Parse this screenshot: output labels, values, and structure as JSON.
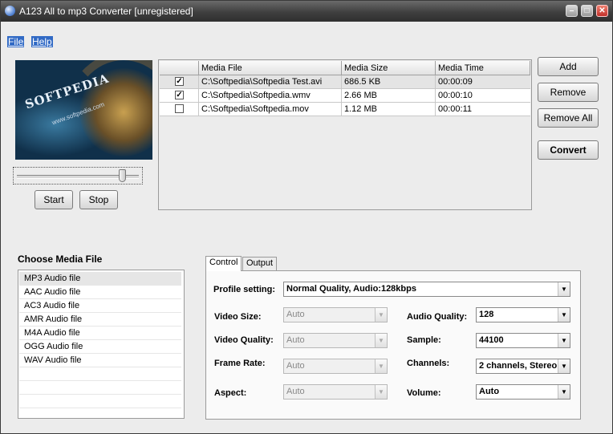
{
  "window": {
    "title": "A123 All to mp3 Converter  [unregistered]",
    "min_glyph": "–",
    "max_glyph": "□",
    "close_glyph": "✕"
  },
  "menu": {
    "items": [
      "File",
      "Help"
    ]
  },
  "preview": {
    "logo_text": "SOFTPEDIA",
    "sub_text": "www.softpedia.com",
    "seek_level": 0.89
  },
  "player": {
    "start": "Start",
    "stop": "Stop"
  },
  "actions": {
    "add": "Add",
    "remove": "Remove",
    "remove_all": "Remove All",
    "convert": "Convert"
  },
  "media_table": {
    "columns": [
      "Media File",
      "Media Size",
      "Media Time"
    ],
    "rows": [
      {
        "checked": true,
        "file": "C:\\Softpedia\\Softpedia Test.avi",
        "size": "686.5 KB",
        "time": "00:00:09"
      },
      {
        "checked": true,
        "file": "C:\\Softpedia\\Softpedia.wmv",
        "size": "2.66 MB",
        "time": "00:00:10"
      },
      {
        "checked": false,
        "file": "C:\\Softpedia\\Softpedia.mov",
        "size": "1.12 MB",
        "time": "00:00:11"
      }
    ],
    "check_glyph": "✓"
  },
  "choose_media": {
    "title": "Choose Media File",
    "items": [
      "MP3 Audio file",
      "AAC Audio file",
      "AC3 Audio file",
      "AMR Audio file",
      "M4A Audio file",
      "OGG Audio file",
      "WAV Audio file"
    ]
  },
  "tabs": [
    "Control",
    "Output"
  ],
  "settings": {
    "profile_label": "Profile setting:",
    "profile_value": "Normal Quality, Audio:128kbps",
    "video_size_label": "Video Size:",
    "video_size_value": "Auto",
    "video_quality_label": "Video Quality:",
    "video_quality_value": "Auto",
    "frame_rate_label": "Frame Rate:",
    "frame_rate_value": "Auto",
    "aspect_label": "Aspect:",
    "aspect_value": "Auto",
    "audio_quality_label": "Audio Quality:",
    "audio_quality_value": "128",
    "sample_label": "Sample:",
    "sample_value": "44100",
    "channels_label": "Channels:",
    "channels_value": "2 channels, Stereo",
    "volume_label": "Volume:",
    "volume_value": "Auto",
    "arrow_glyph": "▼"
  }
}
